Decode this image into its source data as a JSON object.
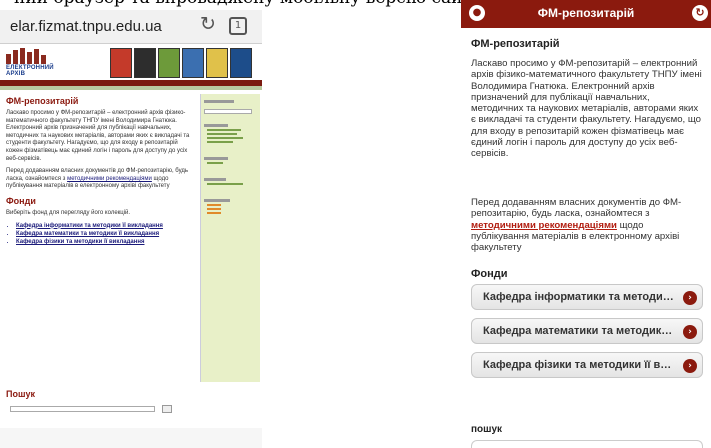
{
  "caption": "ний браузер та впроваджену мобільну версію сайту.",
  "left": {
    "address_url": "elar.fizmat.tnpu.edu.ua",
    "tab_count": "1",
    "logo_text": "ЕЛЕКТРОННИЙ АРХІВ",
    "heading": "ФМ-репозитарій",
    "intro": "Ласкаво просимо у ФМ-репозитарій – електронний архів фізико-математичного факультету ТНПУ імені Володимира Гнатюка. Електронний архів призначений для публікації навчальних, методичних та наукових метаріалів, авторами яких є викладачі та студенти факультету. Нагадуємо, що для входу в репозитарій кожен фізматівець має єдиний логін і пароль для доступу до усіх веб-сервісів.",
    "before_link": "Перед додаванням власних документів до ФМ-репозитарію, будь ласка, ознайомтеся з ",
    "link": "методичними рекомендаціями",
    "after_link": " щодо публікування матеріалів в електронному архіві факультету",
    "funds_heading": "Фонди",
    "funds_intro": "Виберіть фонд для перегляду його колекцій.",
    "funds": [
      "Кафедра інформатики та методики її викладання",
      "Кафедра математики та методики її викладання",
      "Кафедра фізики та методики її викладання"
    ],
    "search_heading": "Пошук"
  },
  "right": {
    "header_title": "ФМ-репозитарій",
    "heading": "ФМ-репозитарій",
    "intro": "Ласкаво просимо у ФМ-репозитарій – електронний архів фізико-математичного факультету ТНПУ імені Володимира Гнатюка. Електронний архів призначений для публікації навчальних, методичних та наукових метаріалів, авторами яких є викладачі та студенти факультету. Нагадуємо, що для входу в репозитарій кожен фізматівець має єдиний логін і пароль для доступу до усіх веб-сервісів.",
    "before_link": "Перед додаванням власних документів до ФМ-репозитарію, будь ласка, ознайомтеся з ",
    "link": "методичними рекомендаціями",
    "after_link": " щодо публікування матеріалів в електронному архіві факультету",
    "funds_heading": "Фонди",
    "buttons": [
      "Кафедра інформатики та методи…",
      "Кафедра математики та методик…",
      "Кафедра фізики та методики її в…"
    ],
    "search_heading": "пошук"
  }
}
